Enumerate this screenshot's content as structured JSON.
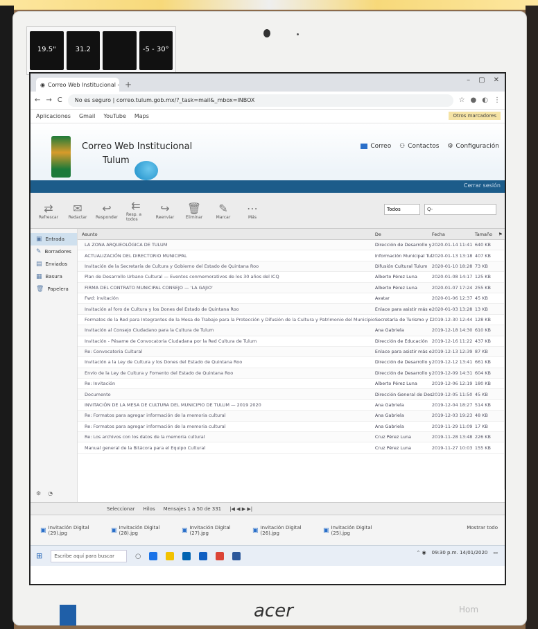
{
  "sticker_labels": [
    {
      "value": "19.5\"",
      "sub": ""
    },
    {
      "value": "31.2",
      "sub": ""
    },
    {
      "value": "",
      "sub": ""
    },
    {
      "value": "-5 - 30°",
      "sub": ""
    }
  ],
  "browser": {
    "tab_title": "Correo Web Institucional - Bande",
    "url": "No es seguro | correo.tulum.gob.mx/?_task=mail&_mbox=INBOX",
    "bookmarks": [
      "Aplicaciones",
      "Gmail",
      "YouTube",
      "Maps"
    ],
    "bookmark_right": "Otros marcadores"
  },
  "header": {
    "title_line1": "Correo Web Institucional",
    "title_line2": "Tulum",
    "links": [
      "Correo",
      "Contactos",
      "Configuración"
    ],
    "user": "Cerrar sesión"
  },
  "toolbar": {
    "buttons": [
      "Refrescar",
      "Redactar",
      "Responder",
      "Resp. a todos",
      "Reenviar",
      "Eliminar",
      "Marcar",
      "Más"
    ],
    "filter": "Todos",
    "search_placeholder": "Q-"
  },
  "sidebar": {
    "folders": [
      "Entrada",
      "Borradores",
      "Enviados",
      "Basura",
      "Papelera"
    ]
  },
  "list": {
    "headers": {
      "subject": "Asunto",
      "from": "De",
      "date": "Fecha",
      "size": "Tamaño"
    },
    "rows": [
      {
        "subject": "LA ZONA ARQUEOLÓGICA DE TULUM",
        "from": "Dirección de Desarrollo y Festejos",
        "date": "2020-01-14 11:41",
        "size": "640 KB"
      },
      {
        "subject": "ACTUALIZACIÓN DEL DIRECTORIO MUNICIPAL",
        "from": "Información Municipal Tulum",
        "date": "2020-01-13 13:18",
        "size": "407 KB"
      },
      {
        "subject": "Invitación de la Secretaría de Cultura y Gobierno del Estado de Quintana Roo",
        "from": "Difusión Cultural Tulum",
        "date": "2020-01-10 18:28",
        "size": "73 KB"
      },
      {
        "subject": "Plan de Desarrollo Urbano Cultural — Eventos conmemorativos de los 30 años del ICQ",
        "from": "Alberto Pérez Luna",
        "date": "2020-01-08 14:17",
        "size": "125 KB"
      },
      {
        "subject": "FIRMA DEL CONTRATO MUNICIPAL CONSEJO — 'LA GAJIO'",
        "from": "Alberto Pérez Luna",
        "date": "2020-01-07 17:24",
        "size": "255 KB"
      },
      {
        "subject": "Fwd: invitación",
        "from": "Avatar",
        "date": "2020-01-06 12:37",
        "size": "45 KB"
      },
      {
        "subject": "Invitación al foro de Cultura y los Dones del Estado de Quintana Roo",
        "from": "Enlace para asistir más eventos",
        "date": "2020-01-03 13:28",
        "size": "13 KB"
      },
      {
        "subject": "Formatos de la Red para Integrantes de la Mesa de Trabajo para la Protección y Difusión de la Cultura y Patrimonio del Municipio",
        "from": "Secretaría de Turismo y Deportes",
        "date": "2019-12-30 12:44",
        "size": "128 KB"
      },
      {
        "subject": "Invitación al Consejo Ciudadano para la Cultura de Tulum",
        "from": "Ana Gabriela",
        "date": "2019-12-18 14:30",
        "size": "610 KB"
      },
      {
        "subject": "Invitación - Pésame de Convocatoria Ciudadana por la Red Cultura de Tulum",
        "from": "Dirección de Educación",
        "date": "2019-12-16 11:22",
        "size": "437 KB"
      },
      {
        "subject": "Re: Convocatoria Cultural",
        "from": "Enlace para asistir más eventos",
        "date": "2019-12-13 12:39",
        "size": "87 KB"
      },
      {
        "subject": "Invitación a la Ley de Cultura y los Dones del Estado de Quintana Roo",
        "from": "Dirección de Desarrollo y Festejos",
        "date": "2019-12-12 13:41",
        "size": "661 KB"
      },
      {
        "subject": "Envío de la Ley de Cultura y Fomento del Estado de Quintana Roo",
        "from": "Dirección de Desarrollo y Festejos",
        "date": "2019-12-09 14:31",
        "size": "604 KB"
      },
      {
        "subject": "Re: Invitación",
        "from": "Alberto Pérez Luna",
        "date": "2019-12-06 12:19",
        "size": "180 KB"
      },
      {
        "subject": "Documento",
        "from": "Dirección General de Desarrollo",
        "date": "2019-12-05 11:50",
        "size": "45 KB"
      },
      {
        "subject": "INVITACIÓN DE LA MESA DE CULTURA DEL MUNICIPIO DE TULUM — 2019 2020",
        "from": "Ana Gabriela",
        "date": "2019-12-04 18:27",
        "size": "514 KB"
      },
      {
        "subject": "Re: Formatos para agregar información de la memoria cultural",
        "from": "Ana Gabriela",
        "date": "2019-12-03 19:23",
        "size": "48 KB"
      },
      {
        "subject": "Re: Formatos para agregar información de la memoria cultural",
        "from": "Ana Gabriela",
        "date": "2019-11-29 11:09",
        "size": "17 KB"
      },
      {
        "subject": "Re: Los archivos con los datos de la memoria cultural",
        "from": "Cruz Pérez Luna",
        "date": "2019-11-28 13:48",
        "size": "226 KB"
      },
      {
        "subject": "Manual general de la Bitácora para el Equipo Cultural",
        "from": "Cruz Pérez Luna",
        "date": "2019-11-27 10:03",
        "size": "155 KB"
      }
    ]
  },
  "pager": {
    "select_label": "Seleccionar",
    "threads_label": "Hilos",
    "info": "Mensajes 1 a 50 de 331"
  },
  "downloads": {
    "items": [
      {
        "name": "Invitación Digital (29).jpg"
      },
      {
        "name": "Invitación Digital (28).jpg"
      },
      {
        "name": "Invitación Digital (27).jpg"
      },
      {
        "name": "Invitación Digital (26).jpg"
      },
      {
        "name": "Invitación Digital (25).jpg"
      }
    ],
    "more": "Mostrar todo"
  },
  "taskbar": {
    "search": "Escribe aquí para buscar",
    "time": "09:30 p.m.",
    "date": "14/01/2020"
  },
  "brand": "acer",
  "brand_right": "Hom"
}
